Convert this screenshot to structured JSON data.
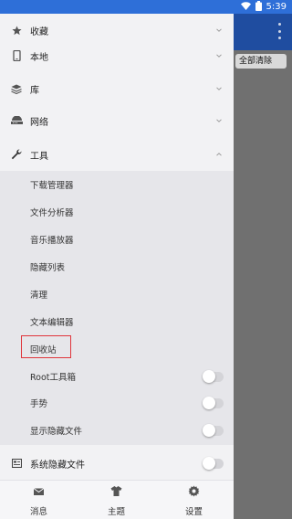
{
  "status_bar": {
    "time": "5:39"
  },
  "background": {
    "clear_all": "全部清除"
  },
  "drawer": {
    "items": [
      {
        "label": "收藏",
        "icon": "star-icon"
      },
      {
        "label": "本地",
        "icon": "phone-icon"
      },
      {
        "label": "库",
        "icon": "library-icon"
      },
      {
        "label": "网络",
        "icon": "network-icon"
      },
      {
        "label": "工具",
        "icon": "wrench-icon"
      }
    ],
    "tools": [
      {
        "label": "下载管理器"
      },
      {
        "label": "文件分析器"
      },
      {
        "label": "音乐播放器"
      },
      {
        "label": "隐藏列表"
      },
      {
        "label": "清理"
      },
      {
        "label": "文本编辑器"
      },
      {
        "label": "回收站"
      },
      {
        "label": "Root工具箱",
        "toggle": false
      },
      {
        "label": "手势",
        "toggle": false
      },
      {
        "label": "显示隐藏文件",
        "toggle": false
      }
    ],
    "system_hidden": {
      "label": "系统隐藏文件",
      "icon": "system-file-icon",
      "toggle": false
    }
  },
  "bottom_nav": [
    {
      "label": "消息",
      "icon": "message-icon"
    },
    {
      "label": "主题",
      "icon": "shirt-icon"
    },
    {
      "label": "设置",
      "icon": "gear-icon"
    }
  ],
  "colors": {
    "status_bar": "#2e6fd8",
    "drawer_bg": "#f2f2f4",
    "highlight": "#e0353b"
  }
}
